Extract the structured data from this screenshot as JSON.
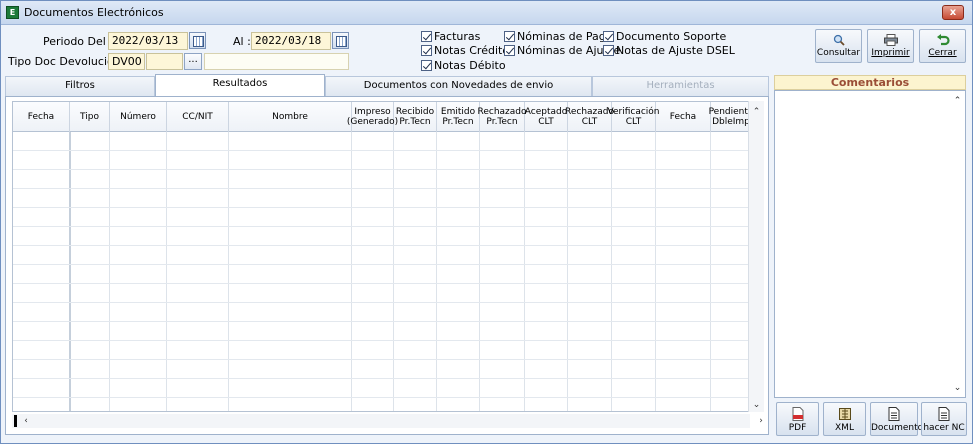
{
  "window": {
    "title": "Documentos Electrónicos",
    "close": "x"
  },
  "filters": {
    "periodo_label": "Periodo  Del :",
    "del_value": "2022/03/13",
    "al_label": "Al :",
    "al_value": "2022/03/18",
    "tipo_label": "Tipo Doc Devolución :",
    "tipo_value": "DV00",
    "dots": "..."
  },
  "checks": [
    {
      "label": "Facturas",
      "checked": true
    },
    {
      "label": "Notas Crédito",
      "checked": true
    },
    {
      "label": "Notas Débito",
      "checked": true
    },
    {
      "label": "Nóminas de Pago",
      "checked": true
    },
    {
      "label": "Nóminas de Ajuste",
      "checked": true
    },
    {
      "label": "Documento Soporte",
      "checked": true
    },
    {
      "label": "Notas de Ajuste DSEL",
      "checked": true
    }
  ],
  "toolbar": {
    "consultar": "Consultar",
    "imprimir": "Imprimir",
    "cerrar": "Cerrar"
  },
  "tabs": [
    {
      "label": "Filtros",
      "state": "normal"
    },
    {
      "label": "Resultados",
      "state": "active"
    },
    {
      "label": "Documentos con Novedades de envio",
      "state": "normal"
    },
    {
      "label": "Herramientas",
      "state": "disabled"
    }
  ],
  "columns": [
    "Fecha",
    "Tipo",
    "Número",
    "CC/NIT",
    "Nombre",
    "Impreso\n(Generado)",
    "Recibido\nPr.Tecn",
    "Emitido\nPr.Tecn",
    "Rechazado\nPr.Tecn",
    "Aceptado\nCLT",
    "Rechazado\nCLT",
    "Verificación\nCLT",
    "Fecha",
    "Pendiente\nDbleImp"
  ],
  "comments": {
    "title": "Comentarios"
  },
  "bottom_buttons": {
    "pdf": "PDF",
    "xml": "XML",
    "documento": "Documento",
    "hacer_nc": "hacer NC"
  },
  "colors": {
    "comments_title": "#9a4d36",
    "field_bg": "#fdf6d8"
  },
  "icons": [
    "app-icon",
    "calendar-icon",
    "search-icon",
    "printer-icon",
    "undo-arrow-icon",
    "pdf-icon",
    "xml-icon",
    "document-icon",
    "hacer-nc-icon"
  ]
}
